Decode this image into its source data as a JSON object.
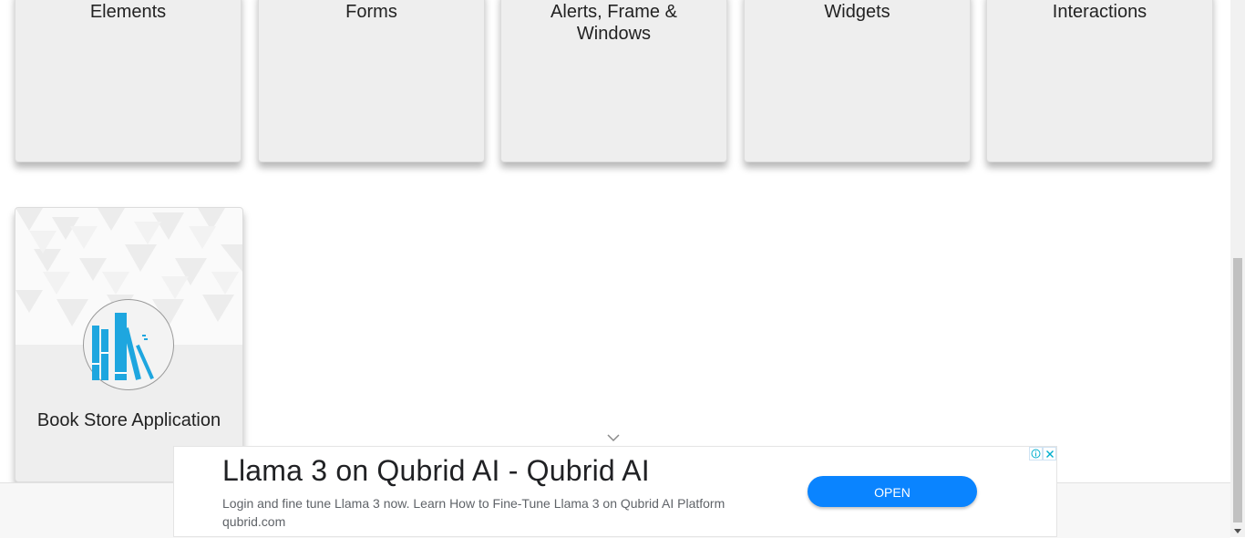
{
  "cards": [
    {
      "title": "Elements"
    },
    {
      "title": "Forms"
    },
    {
      "title": "Alerts, Frame & Windows"
    },
    {
      "title": "Widgets"
    },
    {
      "title": "Interactions"
    }
  ],
  "book_card": {
    "title": "Book Store Application",
    "icon": "books-icon"
  },
  "ad": {
    "headline": "Llama 3 on Qubrid AI - Qubrid AI",
    "description": "Login and fine tune Llama 3 now. Learn How to Fine-Tune Llama 3 on Qubrid AI Platform qubrid.com",
    "open_label": "OPEN",
    "info_icon": "info-icon",
    "close_icon": "close-icon"
  },
  "colors": {
    "accent": "#0a84ff",
    "card_bg": "#eeeeee",
    "book_icon": "#1ea6df"
  }
}
